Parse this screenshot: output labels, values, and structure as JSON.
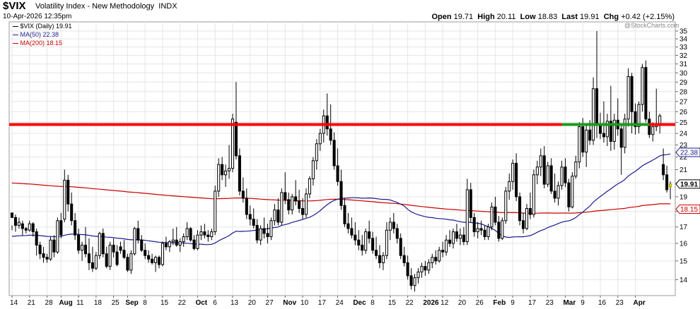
{
  "header": {
    "symbol": "$VIX",
    "description": "Volatility Index - New Methodology",
    "exchange": "INDX",
    "date": "10-Apr-2026 12:35pm",
    "watermark": "@StockCharts.com",
    "ohlc": {
      "open_label": "Open",
      "open": "19.71",
      "high_label": "High",
      "high": "20.11",
      "low_label": "Low",
      "low": "18.83",
      "last_label": "Last",
      "last": "19.91",
      "chg_label": "Chg",
      "chg": "+0.42 (+2.15%)"
    }
  },
  "legend": {
    "main": "$VIX (Daily) 19.91",
    "ma50": "MA(50) 22.38",
    "ma200": "MA(200) 18.15"
  },
  "colors": {
    "candle": "#000000",
    "ma50": "#1a1a8c",
    "ma200": "#cc0000",
    "resistance": "#ff0000",
    "support": "#1a9a1a",
    "grid": "#e6e6e6",
    "last_candle": "#f0e000"
  },
  "chart_data": {
    "type": "candlestick",
    "yscale": "log",
    "ylim": [
      13.2,
      36.2
    ],
    "yticks": [
      14,
      15,
      16,
      17,
      18,
      19,
      20,
      21,
      22,
      23,
      24,
      25,
      26,
      27,
      28,
      29,
      30,
      31,
      32,
      33,
      34,
      35
    ],
    "price_tags": [
      {
        "label": "22.38",
        "value": 22.38,
        "color": "#1a1a8c"
      },
      {
        "label": "19.91",
        "value": 19.91,
        "color": "#000000"
      },
      {
        "label": "18.15",
        "value": 18.15,
        "color": "#cc0000"
      }
    ],
    "xticks": [
      "14",
      "21",
      "28",
      "Aug",
      "11",
      "18",
      "25",
      "Sep",
      "8",
      "15",
      "22",
      "Oct",
      "6",
      "13",
      "20",
      "27",
      "Nov",
      "10",
      "17",
      "24",
      "Dec",
      "8",
      "15",
      "22",
      "2026",
      "12",
      "20",
      "26",
      "Feb",
      "9",
      "17",
      "23",
      "Mar",
      "9",
      "16",
      "23",
      "Apr"
    ],
    "xtick_bars": [
      0,
      5,
      10,
      14,
      19,
      24,
      29,
      33,
      38,
      43,
      48,
      53,
      58,
      63,
      68,
      73,
      78,
      83,
      88,
      93,
      98,
      103,
      108,
      113,
      118,
      123,
      128,
      133,
      138,
      143,
      148,
      153,
      158,
      163,
      168,
      173,
      178
    ],
    "bold_xticks": [
      "Aug",
      "Sep",
      "Oct",
      "Nov",
      "Dec",
      "2026",
      "Feb",
      "Mar",
      "Apr"
    ],
    "resistance_level": 24.8,
    "support_segment": {
      "value": 24.8,
      "from_bar": 157,
      "to_bar": 182
    },
    "candles": [
      [
        17.9,
        17.1,
        16.8,
        17.6
      ],
      [
        17.6,
        17.8,
        16.7,
        17.1
      ],
      [
        17.1,
        17.6,
        16.9,
        17.3
      ],
      [
        17.2,
        17.4,
        16.5,
        16.9
      ],
      [
        16.9,
        17.0,
        16.6,
        16.8
      ],
      [
        16.8,
        17.4,
        16.7,
        17.2
      ],
      [
        17.2,
        17.3,
        16.4,
        16.7
      ],
      [
        16.7,
        16.9,
        15.3,
        15.9
      ],
      [
        15.9,
        16.1,
        15.1,
        15.4
      ],
      [
        15.4,
        15.8,
        14.9,
        15.2
      ],
      [
        15.2,
        15.4,
        14.9,
        15.1
      ],
      [
        15.1,
        16.4,
        15.0,
        16.2
      ],
      [
        16.2,
        16.5,
        15.2,
        15.5
      ],
      [
        15.5,
        17.6,
        15.4,
        17.4
      ],
      [
        17.4,
        17.9,
        16.3,
        16.5
      ],
      [
        17.5,
        21.0,
        17.3,
        20.2
      ],
      [
        20.2,
        20.6,
        18.0,
        18.5
      ],
      [
        18.5,
        19.3,
        17.1,
        17.4
      ],
      [
        17.4,
        17.9,
        16.2,
        16.5
      ],
      [
        16.5,
        16.9,
        15.4,
        15.6
      ],
      [
        15.6,
        16.1,
        15.0,
        15.9
      ],
      [
        15.9,
        17.0,
        15.2,
        15.4
      ],
      [
        15.4,
        16.3,
        14.5,
        14.9
      ],
      [
        14.9,
        15.8,
        14.4,
        14.6
      ],
      [
        14.6,
        15.5,
        14.5,
        15.3
      ],
      [
        15.3,
        16.7,
        15.1,
        16.6
      ],
      [
        16.6,
        16.9,
        15.2,
        15.4
      ],
      [
        15.4,
        15.8,
        14.6,
        14.7
      ],
      [
        14.7,
        16.1,
        14.5,
        15.9
      ],
      [
        15.9,
        16.3,
        15.2,
        15.5
      ],
      [
        15.5,
        15.9,
        14.7,
        14.8
      ],
      [
        15.8,
        16.1,
        15.4,
        15.6
      ],
      [
        15.6,
        16.2,
        15.1,
        15.2
      ],
      [
        15.2,
        15.4,
        14.4,
        14.5
      ],
      [
        14.5,
        15.6,
        14.3,
        15.4
      ],
      [
        15.4,
        17.0,
        15.3,
        16.9
      ],
      [
        16.9,
        17.4,
        16.0,
        16.2
      ],
      [
        16.2,
        16.5,
        15.5,
        15.6
      ],
      [
        15.6,
        16.0,
        15.1,
        15.3
      ],
      [
        15.3,
        15.6,
        14.9,
        15.1
      ],
      [
        15.1,
        15.4,
        14.8,
        14.9
      ],
      [
        14.9,
        15.3,
        14.4,
        15.2
      ],
      [
        15.2,
        15.3,
        14.6,
        14.8
      ],
      [
        14.8,
        16.1,
        14.7,
        16.0
      ],
      [
        16.0,
        16.4,
        15.6,
        15.8
      ],
      [
        15.8,
        16.2,
        15.5,
        16.1
      ],
      [
        16.1,
        16.9,
        15.9,
        16.2
      ],
      [
        16.2,
        17.0,
        15.8,
        15.9
      ],
      [
        15.9,
        16.3,
        15.5,
        16.1
      ],
      [
        16.1,
        16.6,
        15.8,
        16.4
      ],
      [
        16.4,
        17.3,
        16.2,
        16.9
      ],
      [
        16.9,
        17.0,
        16.1,
        16.2
      ],
      [
        16.2,
        16.5,
        15.6,
        15.7
      ],
      [
        15.7,
        16.8,
        15.6,
        16.5
      ],
      [
        16.5,
        17.1,
        16.2,
        16.7
      ],
      [
        16.7,
        17.2,
        16.3,
        16.5
      ],
      [
        16.5,
        16.8,
        16.1,
        16.4
      ],
      [
        16.4,
        16.9,
        16.2,
        16.7
      ],
      [
        16.7,
        19.8,
        16.5,
        19.4
      ],
      [
        19.4,
        21.9,
        19.0,
        21.4
      ],
      [
        21.4,
        22.0,
        20.2,
        20.6
      ],
      [
        20.6,
        21.4,
        19.7,
        20.9
      ],
      [
        20.9,
        23.0,
        20.3,
        21.1
      ],
      [
        21.1,
        25.8,
        20.8,
        25.3
      ],
      [
        25.0,
        29.0,
        21.8,
        22.1
      ],
      [
        22.1,
        22.7,
        19.1,
        19.4
      ],
      [
        19.4,
        20.4,
        18.6,
        18.9
      ],
      [
        18.9,
        19.6,
        17.5,
        17.8
      ],
      [
        17.8,
        18.4,
        17.1,
        17.5
      ],
      [
        17.5,
        18.2,
        16.9,
        17.1
      ],
      [
        17.1,
        17.5,
        16.0,
        16.2
      ],
      [
        16.2,
        17.1,
        15.9,
        16.9
      ],
      [
        16.9,
        17.6,
        16.3,
        16.6
      ],
      [
        16.6,
        17.2,
        16.0,
        16.4
      ],
      [
        16.4,
        17.6,
        16.2,
        17.4
      ],
      [
        17.4,
        18.5,
        17.1,
        18.1
      ],
      [
        18.1,
        18.9,
        17.1,
        17.3
      ],
      [
        17.3,
        19.6,
        17.1,
        19.3
      ],
      [
        19.3,
        20.8,
        18.5,
        18.8
      ],
      [
        18.8,
        19.3,
        17.8,
        18.1
      ],
      [
        18.1,
        19.2,
        17.8,
        19.0
      ],
      [
        19.0,
        20.2,
        18.4,
        18.7
      ],
      [
        18.7,
        19.5,
        17.9,
        18.2
      ],
      [
        18.2,
        18.9,
        17.5,
        17.8
      ],
      [
        17.8,
        19.6,
        17.6,
        19.2
      ],
      [
        19.2,
        20.5,
        18.9,
        20.3
      ],
      [
        20.3,
        22.0,
        19.8,
        21.7
      ],
      [
        21.7,
        23.5,
        21.0,
        23.1
      ],
      [
        23.1,
        24.4,
        22.5,
        24.0
      ],
      [
        24.0,
        26.2,
        23.2,
        25.6
      ],
      [
        25.6,
        27.8,
        23.8,
        24.4
      ],
      [
        24.4,
        26.7,
        23.0,
        23.4
      ],
      [
        23.4,
        24.1,
        21.0,
        21.3
      ],
      [
        21.3,
        22.7,
        19.8,
        20.1
      ],
      [
        20.1,
        21.0,
        18.1,
        18.4
      ],
      [
        18.4,
        18.9,
        17.0,
        17.2
      ],
      [
        17.2,
        17.9,
        16.6,
        16.9
      ],
      [
        16.9,
        17.6,
        16.3,
        16.5
      ],
      [
        16.5,
        17.3,
        15.9,
        16.2
      ],
      [
        16.2,
        16.8,
        15.6,
        15.9
      ],
      [
        15.9,
        16.5,
        15.3,
        15.6
      ],
      [
        15.6,
        16.9,
        15.4,
        16.7
      ],
      [
        16.7,
        17.4,
        16.0,
        16.3
      ],
      [
        16.3,
        16.7,
        15.4,
        15.6
      ],
      [
        15.6,
        16.4,
        15.1,
        15.3
      ],
      [
        15.3,
        15.9,
        14.6,
        14.9
      ],
      [
        14.9,
        15.5,
        14.5,
        15.3
      ],
      [
        15.3,
        17.3,
        15.1,
        16.8
      ],
      [
        16.8,
        17.6,
        16.2,
        17.3
      ],
      [
        17.3,
        17.9,
        16.6,
        16.9
      ],
      [
        16.9,
        17.2,
        16.0,
        16.3
      ],
      [
        16.3,
        16.6,
        15.1,
        15.3
      ],
      [
        15.3,
        15.8,
        14.7,
        14.9
      ],
      [
        14.9,
        15.3,
        14.0,
        14.2
      ],
      [
        14.2,
        14.6,
        13.5,
        13.7
      ],
      [
        13.7,
        14.3,
        13.4,
        14.1
      ],
      [
        14.1,
        14.6,
        13.8,
        14.4
      ],
      [
        14.4,
        14.9,
        14.1,
        14.7
      ],
      [
        14.7,
        15.0,
        14.2,
        14.5
      ],
      [
        14.5,
        15.1,
        14.3,
        14.9
      ],
      [
        14.9,
        15.4,
        14.6,
        15.2
      ],
      [
        15.2,
        15.6,
        14.8,
        15.0
      ],
      [
        15.0,
        15.8,
        14.9,
        15.6
      ],
      [
        15.6,
        16.1,
        15.2,
        15.5
      ],
      [
        15.5,
        16.5,
        15.3,
        16.2
      ],
      [
        16.2,
        16.8,
        15.8,
        16.0
      ],
      [
        16.0,
        16.9,
        15.7,
        16.7
      ],
      [
        16.7,
        17.2,
        16.1,
        16.3
      ],
      [
        16.3,
        16.9,
        15.9,
        16.5
      ],
      [
        16.5,
        17.0,
        15.9,
        16.1
      ],
      [
        16.1,
        20.3,
        15.9,
        19.5
      ],
      [
        19.5,
        20.0,
        17.3,
        17.6
      ],
      [
        17.6,
        17.9,
        16.4,
        16.7
      ],
      [
        16.7,
        17.3,
        16.3,
        16.9
      ],
      [
        16.9,
        17.4,
        16.5,
        16.8
      ],
      [
        16.8,
        17.1,
        16.2,
        16.4
      ],
      [
        16.4,
        17.2,
        16.2,
        17.0
      ],
      [
        17.0,
        18.6,
        16.8,
        18.3
      ],
      [
        18.3,
        19.0,
        17.1,
        17.3
      ],
      [
        17.3,
        17.7,
        16.1,
        16.3
      ],
      [
        16.3,
        17.6,
        16.2,
        17.4
      ],
      [
        17.4,
        19.7,
        17.2,
        19.4
      ],
      [
        19.4,
        20.7,
        18.8,
        20.1
      ],
      [
        20.1,
        21.8,
        19.5,
        21.5
      ],
      [
        21.5,
        22.3,
        18.7,
        19.0
      ],
      [
        19.0,
        19.3,
        17.1,
        17.4
      ],
      [
        17.4,
        17.9,
        16.6,
        16.9
      ],
      [
        16.9,
        18.5,
        16.8,
        18.2
      ],
      [
        18.2,
        19.3,
        17.5,
        17.8
      ],
      [
        17.8,
        21.0,
        17.6,
        20.6
      ],
      [
        20.6,
        21.7,
        19.9,
        21.2
      ],
      [
        21.2,
        22.7,
        20.5,
        22.1
      ],
      [
        22.1,
        22.9,
        19.6,
        19.9
      ],
      [
        19.9,
        21.6,
        19.7,
        21.3
      ],
      [
        21.3,
        21.9,
        19.2,
        19.4
      ],
      [
        19.4,
        20.7,
        18.6,
        18.9
      ],
      [
        18.9,
        20.1,
        18.4,
        19.8
      ],
      [
        19.8,
        21.7,
        19.5,
        21.2
      ],
      [
        21.2,
        21.9,
        19.7,
        20.0
      ],
      [
        20.0,
        20.3,
        18.0,
        18.3
      ],
      [
        18.3,
        20.8,
        18.2,
        20.5
      ],
      [
        20.5,
        22.1,
        20.3,
        21.6
      ],
      [
        21.6,
        25.0,
        21.1,
        24.6
      ],
      [
        24.6,
        25.4,
        22.0,
        22.4
      ],
      [
        22.4,
        24.8,
        21.2,
        24.3
      ],
      [
        24.3,
        25.2,
        23.0,
        23.4
      ],
      [
        23.4,
        29.5,
        23.0,
        28.3
      ],
      [
        28.3,
        35.0,
        23.6,
        24.8
      ],
      [
        24.8,
        25.9,
        23.5,
        24.0
      ],
      [
        24.0,
        27.0,
        23.2,
        23.7
      ],
      [
        23.7,
        25.8,
        22.9,
        25.1
      ],
      [
        25.1,
        28.6,
        22.5,
        23.3
      ],
      [
        23.3,
        25.8,
        22.6,
        25.2
      ],
      [
        25.2,
        27.3,
        23.8,
        24.4
      ],
      [
        24.4,
        24.9,
        20.6,
        22.8
      ],
      [
        22.8,
        25.8,
        22.3,
        25.3
      ],
      [
        25.3,
        30.5,
        24.6,
        29.6
      ],
      [
        29.6,
        30.0,
        24.0,
        26.0
      ],
      [
        26.0,
        26.8,
        23.9,
        24.6
      ],
      [
        24.6,
        27.0,
        24.0,
        26.7
      ],
      [
        26.7,
        31.0,
        26.0,
        30.6
      ],
      [
        30.6,
        31.4,
        25.0,
        25.3
      ],
      [
        25.3,
        26.0,
        23.6,
        23.9
      ],
      [
        23.9,
        25.0,
        23.3,
        24.6
      ],
      [
        24.6,
        28.3,
        24.2,
        24.8
      ],
      [
        24.8,
        25.8,
        24.0,
        25.6
      ],
      [
        21.4,
        22.7,
        20.2,
        20.6
      ],
      [
        20.6,
        21.3,
        19.3,
        19.5
      ],
      [
        19.71,
        20.11,
        18.83,
        19.91
      ]
    ]
  }
}
